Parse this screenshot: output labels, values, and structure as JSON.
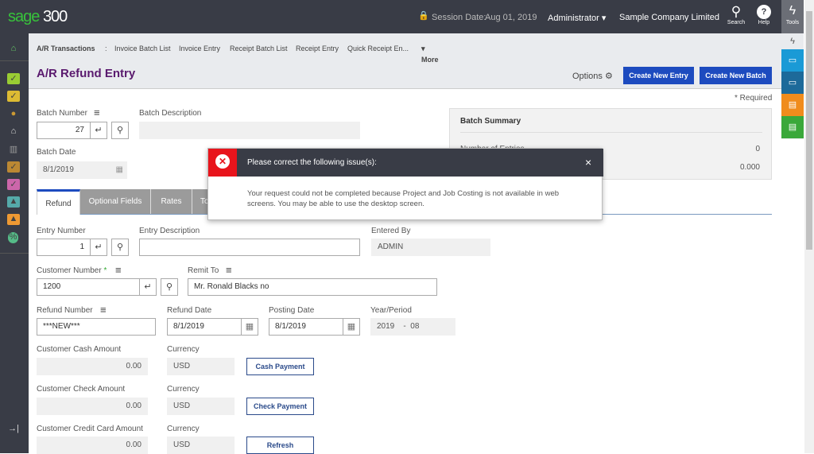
{
  "header": {
    "logo": "sage 300",
    "logo_brand": "sage",
    "logo_num": "300",
    "session_label": "Session Date:",
    "session_date": "Aug 01, 2019",
    "user": "Administrator",
    "company": "Sample Company Limited",
    "search": "Search",
    "help": "Help",
    "tools": "Tools"
  },
  "breadcrumb": {
    "root": "A/R Transactions",
    "sep": ":",
    "items": [
      "Invoice Batch List",
      "Invoice Entry",
      "Receipt Batch List",
      "Receipt Entry",
      "Quick Receipt En..."
    ],
    "more": "More"
  },
  "page": {
    "title": "A/R Refund Entry",
    "options": "Options",
    "create_entry": "Create New Entry",
    "create_batch": "Create New Batch",
    "required": "* Required"
  },
  "batch": {
    "number_label": "Batch Number",
    "number": "27",
    "desc_label": "Batch Description",
    "desc": "",
    "date_label": "Batch Date",
    "date": "8/1/2019"
  },
  "summary": {
    "title": "Batch Summary",
    "entries_label": "Number of Entries",
    "entries": "0",
    "total": "0.000"
  },
  "tabs": [
    "Refund",
    "Optional Fields",
    "Rates",
    "To"
  ],
  "form": {
    "entry_number_label": "Entry Number",
    "entry_number": "1",
    "entry_desc_label": "Entry Description",
    "entry_desc": "",
    "entered_by_label": "Entered By",
    "entered_by": "ADMIN",
    "customer_label": "Customer Number",
    "required_mark": "*",
    "customer": "1200",
    "remit_label": "Remit To",
    "remit": "Mr. Ronald Blacks no",
    "refund_number_label": "Refund Number",
    "refund_number": "***NEW***",
    "refund_date_label": "Refund Date",
    "refund_date": "8/1/2019",
    "posting_date_label": "Posting Date",
    "posting_date": "8/1/2019",
    "year_period_label": "Year/Period",
    "year": "2019",
    "period_sep": "-",
    "period": "08",
    "cash_label": "Customer Cash Amount",
    "cash": "0.00",
    "check_label": "Customer Check Amount",
    "check": "0.00",
    "cc_label": "Customer Credit Card Amount",
    "cc": "0.00",
    "currency_label": "Currency",
    "currency": "USD",
    "cash_btn": "Cash Payment",
    "check_btn": "Check Payment",
    "refresh_btn": "Refresh"
  },
  "dialog": {
    "title": "Please correct the following issue(s):",
    "message": "Your request could not be completed because Project and Job Costing is not available in web screens. You may be able to use the desktop screen.",
    "close": "×"
  },
  "colors": {
    "accent": "#1d4bbf",
    "brand": "#37c23b",
    "error": "#e8141c",
    "title": "#5a1a6e"
  }
}
